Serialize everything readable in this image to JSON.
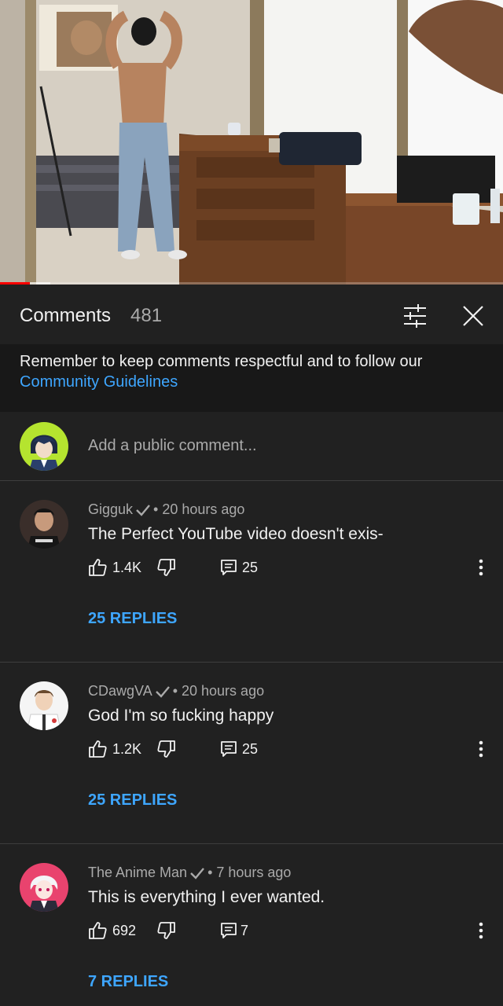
{
  "video": {
    "progress_percent": 6,
    "buffer_percent": 10,
    "accent_color": "#ff0000"
  },
  "comments_header": {
    "title": "Comments",
    "count": "481",
    "filter_icon": "sliders-icon",
    "close_icon": "close-icon"
  },
  "notice": {
    "text": "Remember to keep comments respectful and to follow our",
    "link_label": "Community Guidelines",
    "link_color": "#3ea6ff"
  },
  "add_comment": {
    "placeholder": "Add a public comment..."
  },
  "comments": [
    {
      "author": "Gigguk",
      "verified": true,
      "time": "• 20 hours ago",
      "text": "The Perfect YouTube video doesn't exis-",
      "likes": "1.4K",
      "reply_count": "25",
      "replies_label": "25 REPLIES"
    },
    {
      "author": "CDawgVA",
      "verified": true,
      "time": "• 20 hours ago",
      "text": "God I'm so fucking happy",
      "likes": "1.2K",
      "reply_count": "25",
      "replies_label": "25 REPLIES"
    },
    {
      "author": "The Anime Man",
      "verified": true,
      "time": "• 7 hours ago",
      "text": "This is everything I ever wanted.",
      "likes": "692",
      "reply_count": "7",
      "replies_label": "7 REPLIES"
    }
  ]
}
